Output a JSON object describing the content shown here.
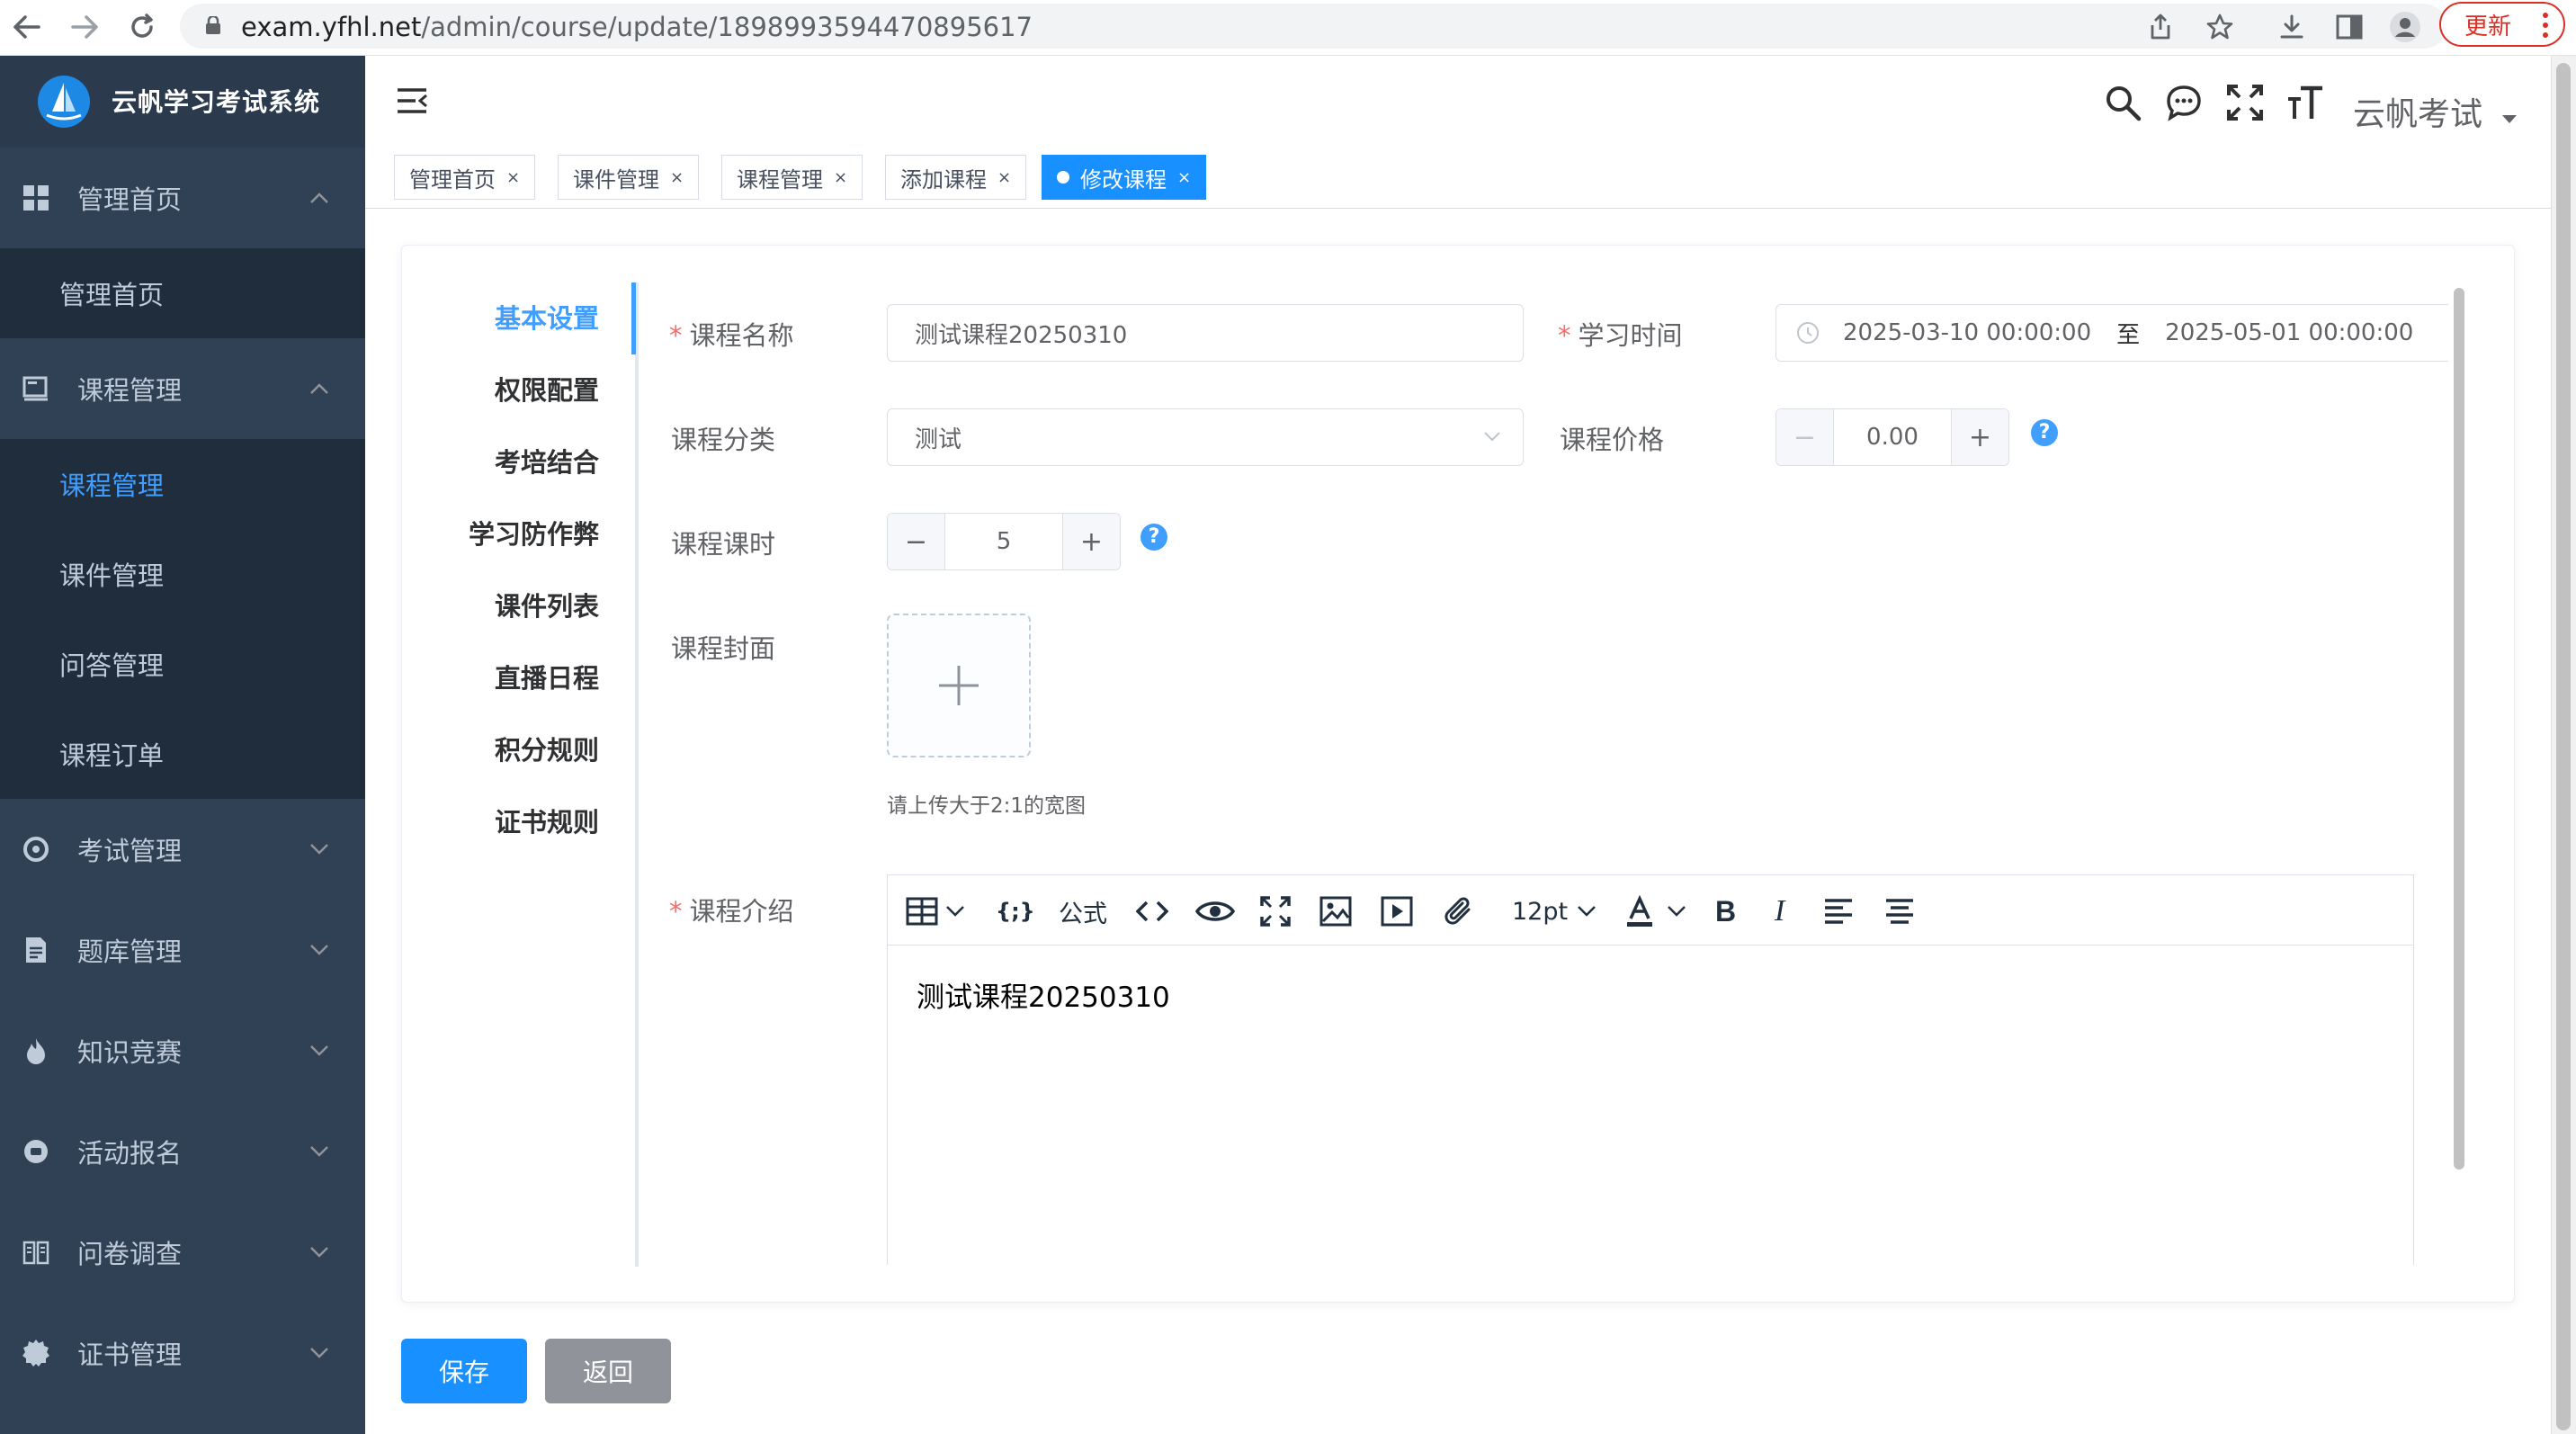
{
  "browser": {
    "url_host": "exam.yfhl.net",
    "url_path": "/admin/course/update/1898993594470895617",
    "update_label": "更新"
  },
  "app": {
    "title": "云帆学习考试系统",
    "user_name": "云帆考试"
  },
  "sidebar": {
    "menus": [
      {
        "label": "管理首页",
        "icon": "dashboard-icon",
        "expanded": true,
        "children": [
          "管理首页"
        ]
      },
      {
        "label": "课程管理",
        "icon": "course-icon",
        "expanded": true,
        "children": [
          "课程管理",
          "课件管理",
          "问答管理",
          "课程订单"
        ],
        "active_child": 0
      },
      {
        "label": "考试管理",
        "icon": "exam-icon",
        "expanded": false
      },
      {
        "label": "题库管理",
        "icon": "document-icon",
        "expanded": false
      },
      {
        "label": "知识竞赛",
        "icon": "fire-icon",
        "expanded": false
      },
      {
        "label": "活动报名",
        "icon": "activity-icon",
        "expanded": false
      },
      {
        "label": "问卷调查",
        "icon": "book-icon",
        "expanded": false
      },
      {
        "label": "证书管理",
        "icon": "badge-icon",
        "expanded": false
      }
    ]
  },
  "tags": [
    {
      "label": "管理首页",
      "active": false
    },
    {
      "label": "课件管理",
      "active": false
    },
    {
      "label": "课程管理",
      "active": false
    },
    {
      "label": "添加课程",
      "active": false
    },
    {
      "label": "修改课程",
      "active": true
    }
  ],
  "steps": [
    "基本设置",
    "权限配置",
    "考培结合",
    "学习防作弊",
    "课件列表",
    "直播日程",
    "积分规则",
    "证书规则"
  ],
  "form": {
    "course_name_label": "课程名称",
    "course_name_value": "测试课程20250310",
    "study_time_label": "学习时间",
    "study_time_start": "2025-03-10 00:00:00",
    "study_time_sep": "至",
    "study_time_end": "2025-05-01 00:00:00",
    "category_label": "课程分类",
    "category_value": "测试",
    "price_label": "课程价格",
    "price_value": "0.00",
    "hours_label": "课程课时",
    "hours_value": "5",
    "cover_label": "课程封面",
    "cover_tip": "请上传大于2:1的宽图",
    "intro_label": "课程介绍",
    "intro_content": "测试课程20250310"
  },
  "editor_toolbar": {
    "formula_label": "公式",
    "font_size": "12pt"
  },
  "actions": {
    "save_label": "保存",
    "back_label": "返回"
  }
}
